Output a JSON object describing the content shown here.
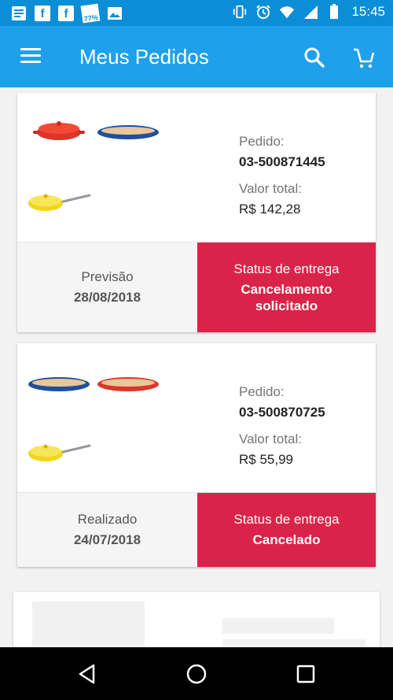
{
  "status_bar": {
    "time": "15:45",
    "battery_percent_badge": "77%",
    "left_icons": [
      "message-icon",
      "facebook-icon",
      "facebook-icon",
      "percent-icon",
      "gallery-icon"
    ],
    "right_icons": [
      "vibrate-icon",
      "alarm-icon",
      "wifi-icon",
      "signal-icon",
      "battery-icon"
    ]
  },
  "app_bar": {
    "title": "Meus Pedidos",
    "color": "#1ea0ea"
  },
  "orders": [
    {
      "products": [
        {
          "name": "red-casserole",
          "color": "#e0342a"
        },
        {
          "name": "blue-oval-dish",
          "color": "#1f4fa0"
        },
        {
          "name": "yellow-skillet",
          "color": "#f2d51c"
        }
      ],
      "order_label": "Pedido:",
      "order_number": "03-500871445",
      "total_label": "Valor total:",
      "total_value": "R$ 142,28",
      "date_label": "Previsão",
      "date_value": "28/08/2018",
      "status_label": "Status de entrega",
      "status_value_line1": "Cancelamento",
      "status_value_line2": "solicitado"
    },
    {
      "products": [
        {
          "name": "blue-oval-dish",
          "color": "#1f4fa0"
        },
        {
          "name": "red-oval-dish",
          "color": "#e0342a"
        },
        {
          "name": "yellow-skillet",
          "color": "#f2d51c"
        }
      ],
      "order_label": "Pedido:",
      "order_number": "03-500870725",
      "total_label": "Valor total:",
      "total_value": "R$ 55,99",
      "date_label": "Realizado",
      "date_value": "24/07/2018",
      "status_label": "Status de entrega",
      "status_value_line1": "Cancelado",
      "status_value_line2": ""
    }
  ],
  "colors": {
    "status_red": "#da2348",
    "status_bar": "#0a8ed6"
  },
  "nav_bar": {
    "icons": [
      "back-icon",
      "home-icon",
      "recents-icon"
    ]
  }
}
